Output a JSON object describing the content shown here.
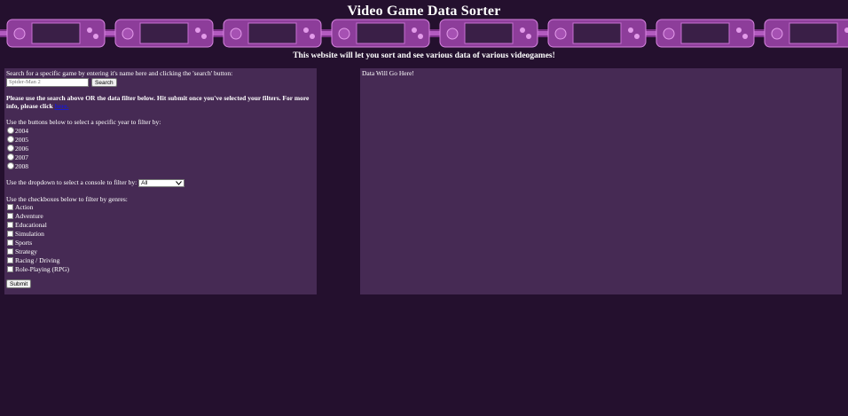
{
  "header": {
    "title": "Video Game Data Sorter",
    "subtitle": "This website will let you sort and see various data of various videogames!"
  },
  "search": {
    "instruction": "Search for a specific game by entering it's name here and clicking the 'search' button:",
    "placeholder": "Spider-Man 2",
    "button_label": "Search"
  },
  "filter_note": {
    "text": "Please use the search above OR the data filter below. Hit submit once you've selected your filters. For more info, please click",
    "link_text": "here."
  },
  "years": {
    "instruction": "Use the buttons below to select a specific year to filter by:",
    "options": [
      "2004",
      "2005",
      "2006",
      "2007",
      "2008"
    ]
  },
  "console": {
    "instruction": "Use the dropdown to select a console to filter by:",
    "selected": "All"
  },
  "genres": {
    "instruction": "Use the checkboxes below to filter by genres:",
    "options": [
      "Action",
      "Adventure",
      "Educational",
      "Simulation",
      "Sports",
      "Strategy",
      "Racing / Driving",
      "Role-Playing (RPG)"
    ]
  },
  "submit_label": "Submit",
  "results": {
    "placeholder": "Data Will Go Here!"
  },
  "colors": {
    "background": "#24102e",
    "panel": "#462a54",
    "banner_accent": "#b35bc0"
  }
}
